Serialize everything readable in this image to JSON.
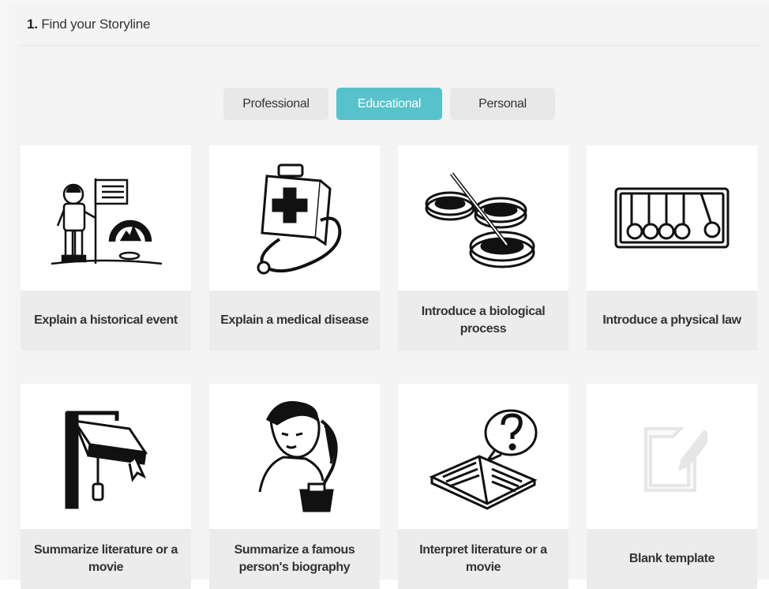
{
  "section": {
    "number": "1.",
    "title": "Find your Storyline"
  },
  "tabs": [
    {
      "label": "Professional",
      "active": false
    },
    {
      "label": "Educational",
      "active": true
    },
    {
      "label": "Personal",
      "active": false
    }
  ],
  "colors": {
    "accent": "#58c2cb",
    "tab_bg": "#e8e8e8",
    "label_bg": "#ececec"
  },
  "cards": [
    {
      "label": "Explain a historical event",
      "icon": "astronaut-icon"
    },
    {
      "label": "Explain a medical disease",
      "icon": "medical-kit-icon"
    },
    {
      "label": "Introduce a biological process",
      "icon": "petri-dish-icon"
    },
    {
      "label": "Introduce a physical law",
      "icon": "newtons-cradle-icon"
    },
    {
      "label": "Summarize literature or a movie",
      "icon": "book-clamp-icon"
    },
    {
      "label": "Summarize a famous person's biography",
      "icon": "portrait-quill-icon"
    },
    {
      "label": "Interpret literature or a movie",
      "icon": "book-question-icon"
    },
    {
      "label": "Blank template",
      "icon": "blank-document-icon"
    }
  ]
}
